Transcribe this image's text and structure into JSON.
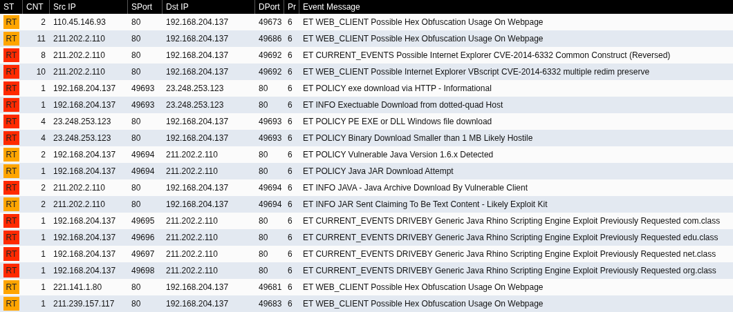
{
  "table": {
    "columns": [
      "ST",
      "CNT",
      "Src IP",
      "SPort",
      "Dst IP",
      "DPort",
      "Pr",
      "Event Message"
    ],
    "rows": [
      {
        "status": "RT",
        "color": "#ffa500",
        "cnt": "2",
        "src_ip": "110.45.146.93",
        "sport": "80",
        "dst_ip": "192.168.204.137",
        "dport": "49673",
        "pr": "6",
        "message": "ET WEB_CLIENT Possible Hex Obfuscation Usage On Webpage"
      },
      {
        "status": "RT",
        "color": "#ffa500",
        "cnt": "11",
        "src_ip": "211.202.2.110",
        "sport": "80",
        "dst_ip": "192.168.204.137",
        "dport": "49686",
        "pr": "6",
        "message": "ET WEB_CLIENT Possible Hex Obfuscation Usage On Webpage"
      },
      {
        "status": "RT",
        "color": "#ff2a00",
        "cnt": "8",
        "src_ip": "211.202.2.110",
        "sport": "80",
        "dst_ip": "192.168.204.137",
        "dport": "49692",
        "pr": "6",
        "message": "ET CURRENT_EVENTS Possible Internet Explorer CVE-2014-6332 Common Construct (Reversed)"
      },
      {
        "status": "RT",
        "color": "#ff2a00",
        "cnt": "10",
        "src_ip": "211.202.2.110",
        "sport": "80",
        "dst_ip": "192.168.204.137",
        "dport": "49692",
        "pr": "6",
        "message": "ET WEB_CLIENT Possible Internet Explorer VBscript CVE-2014-6332 multiple redim preserve"
      },
      {
        "status": "RT",
        "color": "#ff2a00",
        "cnt": "1",
        "src_ip": "192.168.204.137",
        "sport": "49693",
        "dst_ip": "23.248.253.123",
        "dport": "80",
        "pr": "6",
        "message": "ET POLICY exe download via HTTP - Informational"
      },
      {
        "status": "RT",
        "color": "#ff2a00",
        "cnt": "1",
        "src_ip": "192.168.204.137",
        "sport": "49693",
        "dst_ip": "23.248.253.123",
        "dport": "80",
        "pr": "6",
        "message": "ET INFO Exectuable Download from dotted-quad Host"
      },
      {
        "status": "RT",
        "color": "#ff2a00",
        "cnt": "4",
        "src_ip": "23.248.253.123",
        "sport": "80",
        "dst_ip": "192.168.204.137",
        "dport": "49693",
        "pr": "6",
        "message": "ET POLICY PE EXE or DLL Windows file download"
      },
      {
        "status": "RT",
        "color": "#ff2a00",
        "cnt": "4",
        "src_ip": "23.248.253.123",
        "sport": "80",
        "dst_ip": "192.168.204.137",
        "dport": "49693",
        "pr": "6",
        "message": "ET POLICY Binary Download Smaller than 1 MB Likely Hostile"
      },
      {
        "status": "RT",
        "color": "#ffa500",
        "cnt": "2",
        "src_ip": "192.168.204.137",
        "sport": "49694",
        "dst_ip": "211.202.2.110",
        "dport": "80",
        "pr": "6",
        "message": "ET POLICY Vulnerable Java Version 1.6.x Detected"
      },
      {
        "status": "RT",
        "color": "#ffa500",
        "cnt": "1",
        "src_ip": "192.168.204.137",
        "sport": "49694",
        "dst_ip": "211.202.2.110",
        "dport": "80",
        "pr": "6",
        "message": "ET POLICY Java JAR Download Attempt"
      },
      {
        "status": "RT",
        "color": "#ff2a00",
        "cnt": "2",
        "src_ip": "211.202.2.110",
        "sport": "80",
        "dst_ip": "192.168.204.137",
        "dport": "49694",
        "pr": "6",
        "message": "ET INFO JAVA - Java Archive Download By Vulnerable Client"
      },
      {
        "status": "RT",
        "color": "#ffa500",
        "cnt": "2",
        "src_ip": "211.202.2.110",
        "sport": "80",
        "dst_ip": "192.168.204.137",
        "dport": "49694",
        "pr": "6",
        "message": "ET INFO JAR Sent Claiming To Be Text Content - Likely Exploit Kit"
      },
      {
        "status": "RT",
        "color": "#ff2a00",
        "cnt": "1",
        "src_ip": "192.168.204.137",
        "sport": "49695",
        "dst_ip": "211.202.2.110",
        "dport": "80",
        "pr": "6",
        "message": "ET CURRENT_EVENTS DRIVEBY Generic Java Rhino Scripting Engine Exploit Previously Requested com.class"
      },
      {
        "status": "RT",
        "color": "#ff2a00",
        "cnt": "1",
        "src_ip": "192.168.204.137",
        "sport": "49696",
        "dst_ip": "211.202.2.110",
        "dport": "80",
        "pr": "6",
        "message": "ET CURRENT_EVENTS DRIVEBY Generic Java Rhino Scripting Engine Exploit Previously Requested edu.class"
      },
      {
        "status": "RT",
        "color": "#ff2a00",
        "cnt": "1",
        "src_ip": "192.168.204.137",
        "sport": "49697",
        "dst_ip": "211.202.2.110",
        "dport": "80",
        "pr": "6",
        "message": "ET CURRENT_EVENTS DRIVEBY Generic Java Rhino Scripting Engine Exploit Previously Requested net.class"
      },
      {
        "status": "RT",
        "color": "#ff2a00",
        "cnt": "1",
        "src_ip": "192.168.204.137",
        "sport": "49698",
        "dst_ip": "211.202.2.110",
        "dport": "80",
        "pr": "6",
        "message": "ET CURRENT_EVENTS DRIVEBY Generic Java Rhino Scripting Engine Exploit Previously Requested org.class"
      },
      {
        "status": "RT",
        "color": "#ffa500",
        "cnt": "1",
        "src_ip": "221.141.1.80",
        "sport": "80",
        "dst_ip": "192.168.204.137",
        "dport": "49681",
        "pr": "6",
        "message": "ET WEB_CLIENT Possible Hex Obfuscation Usage On Webpage"
      },
      {
        "status": "RT",
        "color": "#ffa500",
        "cnt": "1",
        "src_ip": "211.239.157.117",
        "sport": "80",
        "dst_ip": "192.168.204.137",
        "dport": "49683",
        "pr": "6",
        "message": "ET WEB_CLIENT Possible Hex Obfuscation Usage On Webpage"
      }
    ]
  }
}
